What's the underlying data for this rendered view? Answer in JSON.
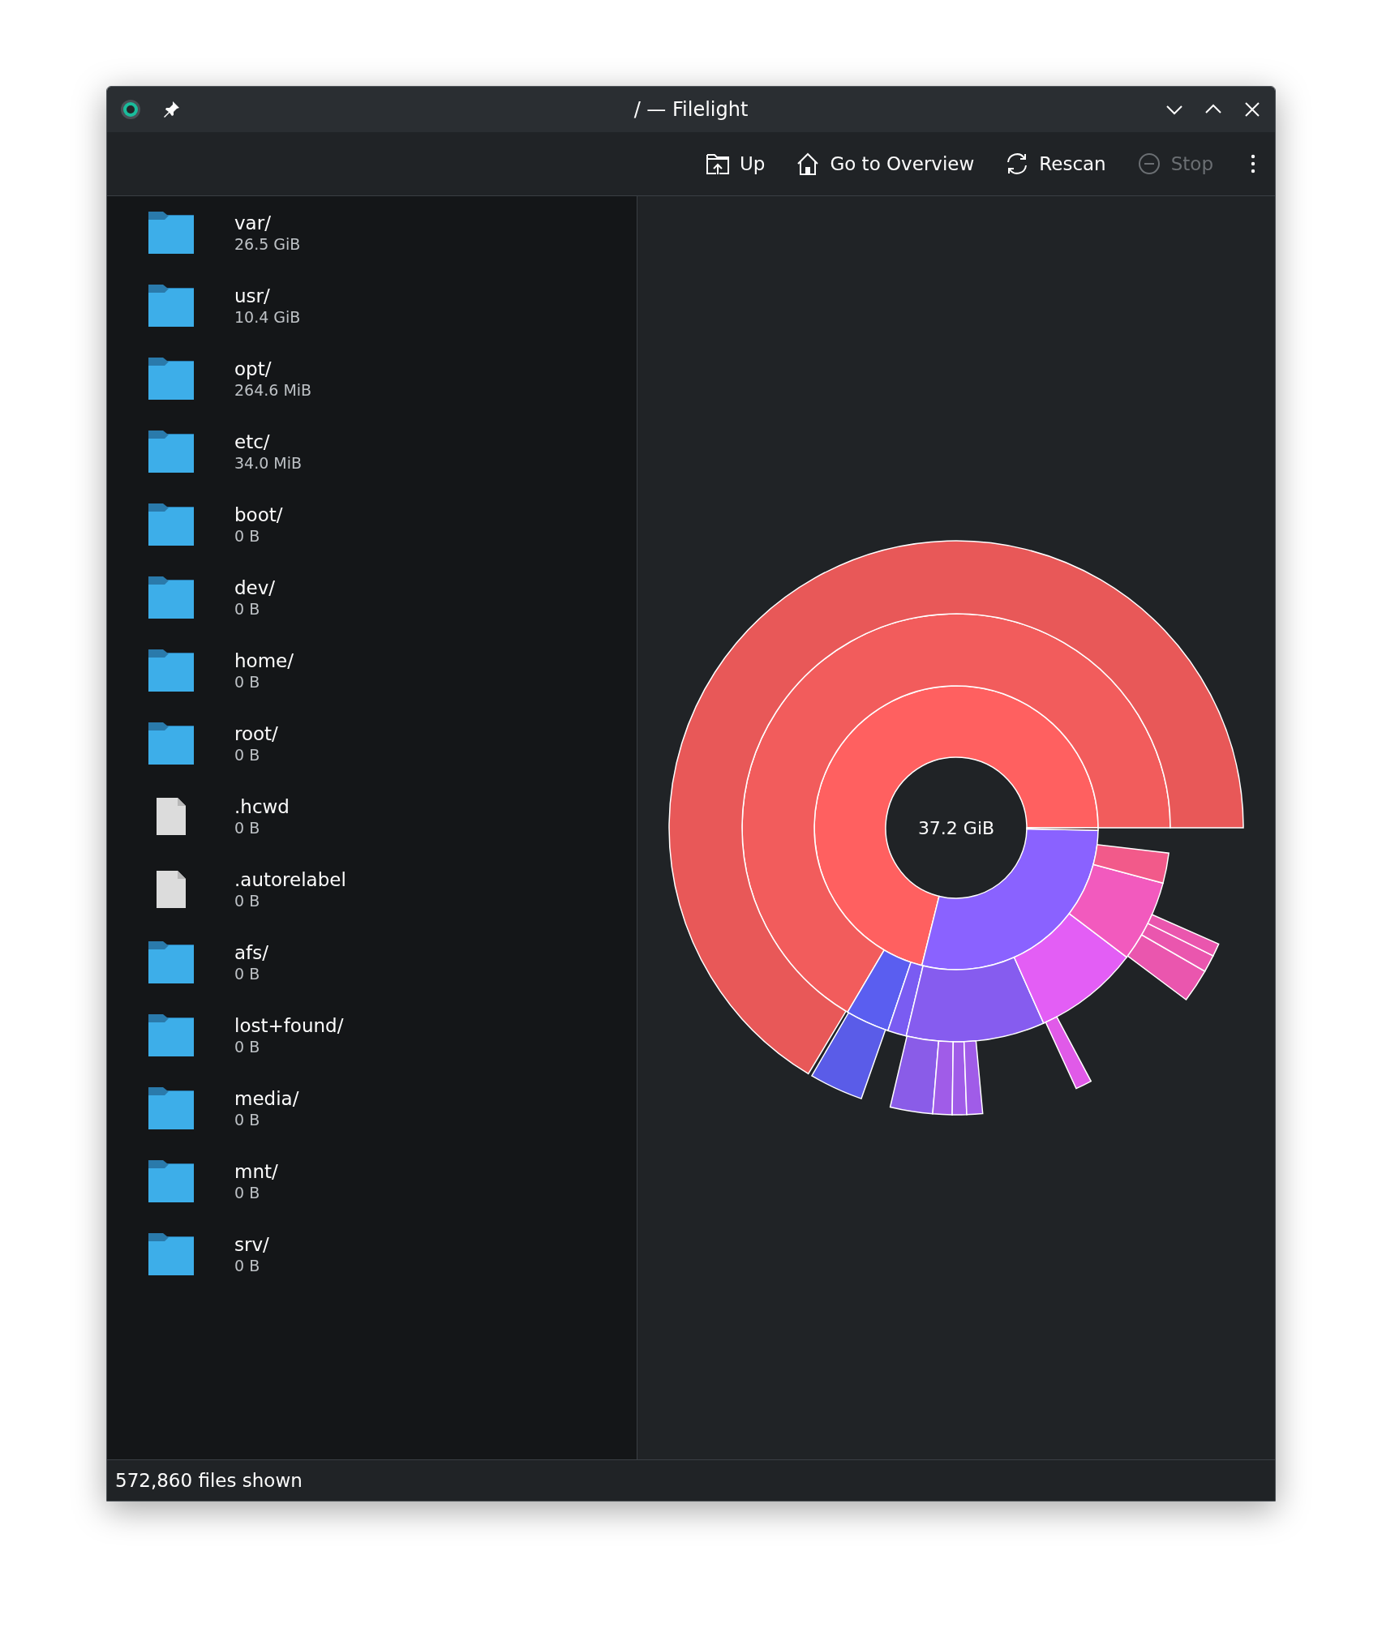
{
  "window": {
    "title": "/ — Filelight"
  },
  "toolbar": {
    "buttons": [
      {
        "kind": "up",
        "label": "Up",
        "disabled": false
      },
      {
        "kind": "home",
        "label": "Go to Overview",
        "disabled": false
      },
      {
        "kind": "rescan",
        "label": "Rescan",
        "disabled": false
      },
      {
        "kind": "stop",
        "label": "Stop",
        "disabled": true
      }
    ]
  },
  "file_list": [
    {
      "kind": "folder",
      "name": "var/",
      "size": "26.5 GiB"
    },
    {
      "kind": "folder",
      "name": "usr/",
      "size": "10.4 GiB"
    },
    {
      "kind": "folder",
      "name": "opt/",
      "size": "264.6 MiB"
    },
    {
      "kind": "folder",
      "name": "etc/",
      "size": "34.0 MiB"
    },
    {
      "kind": "folder",
      "name": "boot/",
      "size": "0 B"
    },
    {
      "kind": "folder",
      "name": "dev/",
      "size": "0 B"
    },
    {
      "kind": "folder",
      "name": "home/",
      "size": "0 B"
    },
    {
      "kind": "folder",
      "name": "root/",
      "size": "0 B"
    },
    {
      "kind": "file",
      "name": ".hcwd",
      "size": "0 B"
    },
    {
      "kind": "file",
      "name": ".autorelabel",
      "size": "0 B"
    },
    {
      "kind": "folder",
      "name": "afs/",
      "size": "0 B"
    },
    {
      "kind": "folder",
      "name": "lost+found/",
      "size": "0 B"
    },
    {
      "kind": "folder",
      "name": "media/",
      "size": "0 B"
    },
    {
      "kind": "folder",
      "name": "mnt/",
      "size": "0 B"
    },
    {
      "kind": "folder",
      "name": "srv/",
      "size": "0 B"
    }
  ],
  "chart": {
    "center_label": "37.2 GiB"
  },
  "status_bar": {
    "text": "572,860 files shown"
  }
}
